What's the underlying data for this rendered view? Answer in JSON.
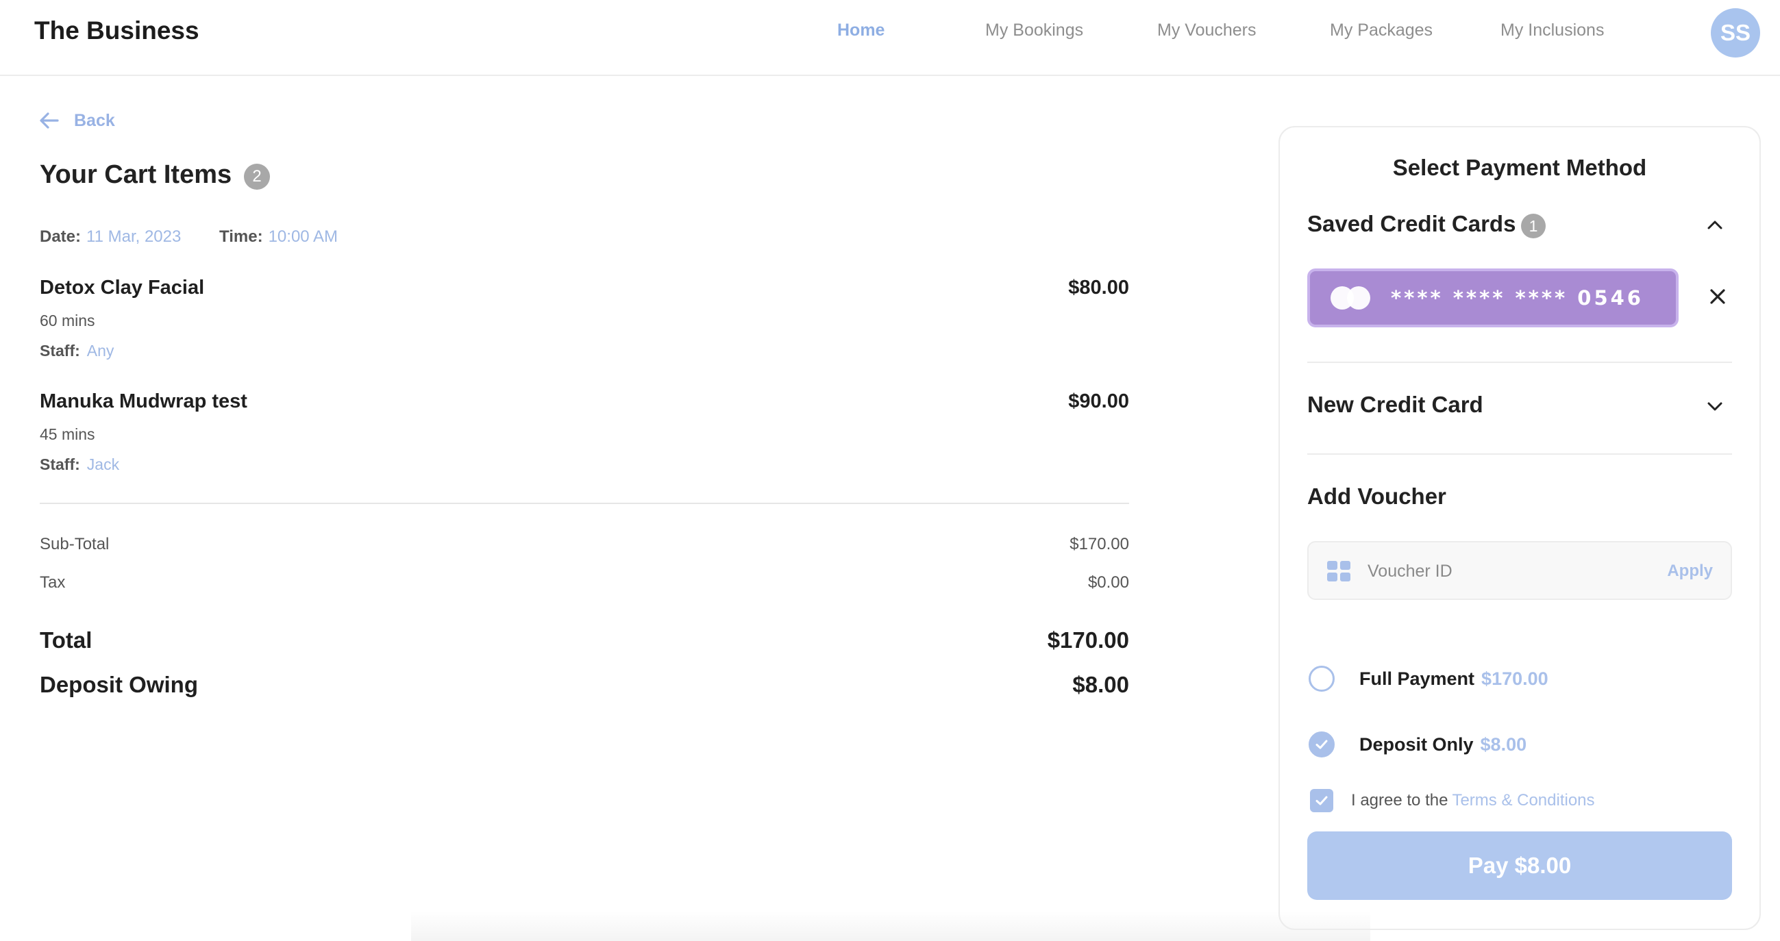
{
  "header": {
    "brand": "The Business",
    "nav": [
      {
        "label": "Home",
        "active": true
      },
      {
        "label": "My Bookings",
        "active": false
      },
      {
        "label": "My Vouchers",
        "active": false
      },
      {
        "label": "My Packages",
        "active": false
      },
      {
        "label": "My Inclusions",
        "active": false
      }
    ],
    "avatar_initials": "SS"
  },
  "back_label": "Back",
  "cart": {
    "title": "Your Cart Items",
    "count": "2",
    "date_label": "Date:",
    "date_value": "11 Mar, 2023",
    "time_label": "Time:",
    "time_value": "10:00 AM",
    "items": [
      {
        "name": "Detox Clay Facial",
        "price": "$80.00",
        "duration": "60 mins",
        "staff_label": "Staff:",
        "staff": "Any"
      },
      {
        "name": "Manuka Mudwrap test",
        "price": "$90.00",
        "duration": "45 mins",
        "staff_label": "Staff:",
        "staff": "Jack"
      }
    ],
    "subtotal_label": "Sub-Total",
    "subtotal_value": "$170.00",
    "tax_label": "Tax",
    "tax_value": "$0.00",
    "total_label": "Total",
    "total_value": "$170.00",
    "deposit_label": "Deposit Owing",
    "deposit_value": "$8.00"
  },
  "payment": {
    "title": "Select Payment Method",
    "saved_cards_label": "Saved Credit Cards",
    "saved_cards_count": "1",
    "card_number": "**** **** **** 0546",
    "new_card_label": "New Credit Card",
    "voucher_title": "Add Voucher",
    "voucher_placeholder": "Voucher ID",
    "apply_label": "Apply",
    "full_payment_label": "Full Payment",
    "full_payment_amount": "$170.00",
    "deposit_only_label": "Deposit Only",
    "deposit_only_amount": "$8.00",
    "agree_text": "I agree to the",
    "terms_link": "Terms & Conditions",
    "pay_button": "Pay $8.00"
  },
  "colors": {
    "accent": "#a9c0ea",
    "card": "#a98bd3",
    "badge": "#a8a8a8"
  }
}
